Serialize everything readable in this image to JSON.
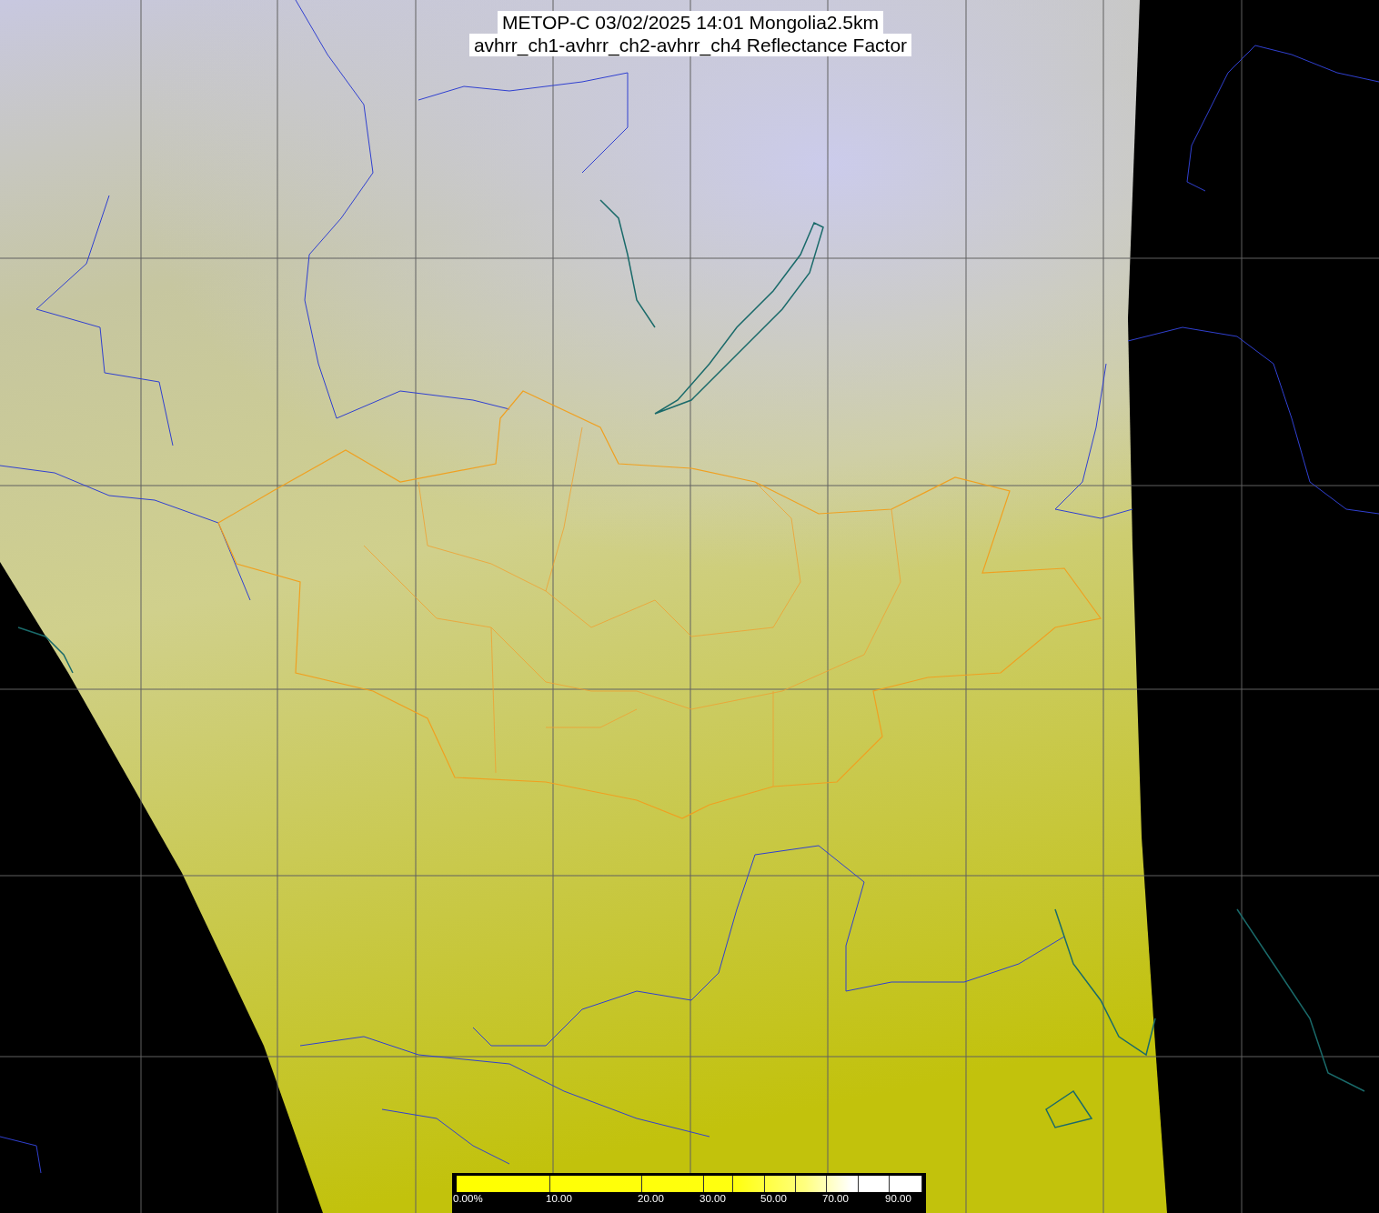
{
  "title": {
    "lines": [
      "METOP-C 03/02/2025 14:01 Mongolia2.5km",
      "avhrr_ch1-avhrr_ch2-avhrr_ch4 Reflectance Factor"
    ]
  },
  "colorbar": {
    "labels": [
      "0.00%",
      "10.00",
      "20.00",
      "30.00",
      "50.00",
      "70.00",
      "90.00"
    ]
  }
}
